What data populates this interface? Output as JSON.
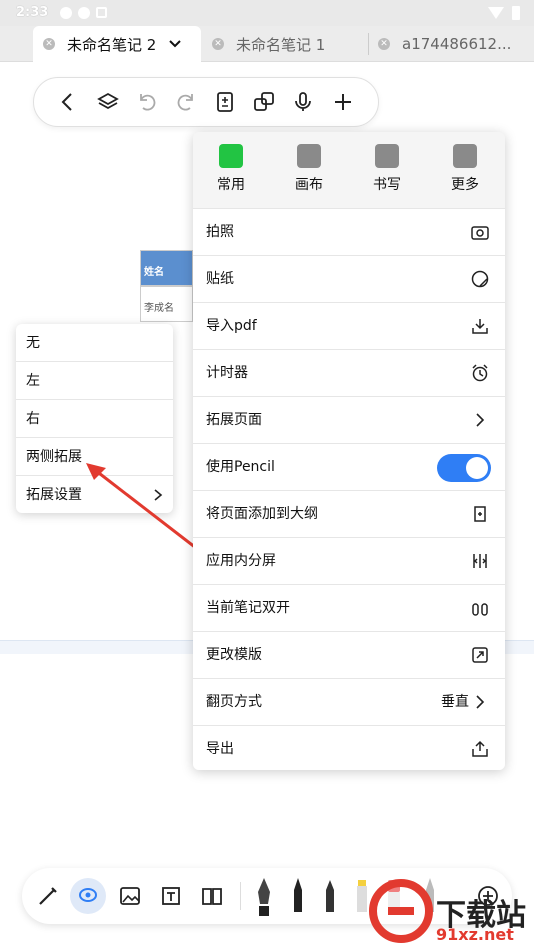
{
  "status_bar": {
    "time": "2:33"
  },
  "tabs": [
    {
      "label": "未命名笔记 2",
      "active": true
    },
    {
      "label": "未命名笔记 1",
      "active": false
    },
    {
      "label": "a174486612...",
      "active": false
    }
  ],
  "background_table": {
    "header": "姓名",
    "row1": "李成名"
  },
  "left_menu": {
    "items": [
      {
        "label": "无"
      },
      {
        "label": "左"
      },
      {
        "label": "右"
      },
      {
        "label": "两侧拓展"
      },
      {
        "label": "拓展设置"
      }
    ]
  },
  "right_menu": {
    "categories": [
      {
        "label": "常用",
        "icon": "grid-icon",
        "selected": true
      },
      {
        "label": "画布",
        "icon": "canvas-icon",
        "selected": false
      },
      {
        "label": "书写",
        "icon": "pen-icon",
        "selected": false
      },
      {
        "label": "更多",
        "icon": "more-icon",
        "selected": false
      }
    ],
    "items": [
      {
        "label": "拍照",
        "icon": "camera-icon"
      },
      {
        "label": "贴纸",
        "icon": "sticker-icon"
      },
      {
        "label": "导入pdf",
        "icon": "import-icon"
      },
      {
        "label": "计时器",
        "icon": "alarm-icon"
      },
      {
        "label": "拓展页面",
        "icon": "chevron-right-icon"
      },
      {
        "label": "使用Pencil",
        "toggle": true
      },
      {
        "label": "将页面添加到大纲",
        "icon": "outline-add-icon"
      },
      {
        "label": "应用内分屏",
        "icon": "split-screen-icon"
      },
      {
        "label": "当前笔记双开",
        "icon": "dual-open-icon"
      },
      {
        "label": "更改模版",
        "icon": "template-icon"
      },
      {
        "label": "翻页方式",
        "value": "垂直",
        "icon": "chevron-right-icon"
      },
      {
        "label": "导出",
        "icon": "export-icon"
      }
    ]
  },
  "colors": {
    "accent_green": "#22c443",
    "toggle_blue": "#2f7ef5",
    "arrow_red": "#e23a2f"
  },
  "watermark": {
    "text": "下载站",
    "url": "91xz.net"
  }
}
